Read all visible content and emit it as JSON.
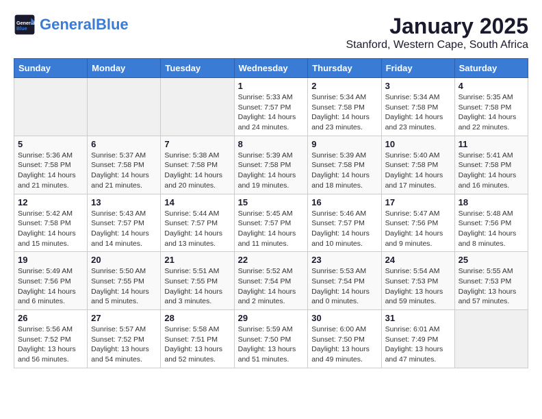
{
  "logo": {
    "text_general": "General",
    "text_blue": "Blue"
  },
  "title": "January 2025",
  "subtitle": "Stanford, Western Cape, South Africa",
  "headers": [
    "Sunday",
    "Monday",
    "Tuesday",
    "Wednesday",
    "Thursday",
    "Friday",
    "Saturday"
  ],
  "weeks": [
    [
      {
        "num": "",
        "info": ""
      },
      {
        "num": "",
        "info": ""
      },
      {
        "num": "",
        "info": ""
      },
      {
        "num": "1",
        "info": "Sunrise: 5:33 AM\nSunset: 7:57 PM\nDaylight: 14 hours\nand 24 minutes."
      },
      {
        "num": "2",
        "info": "Sunrise: 5:34 AM\nSunset: 7:58 PM\nDaylight: 14 hours\nand 23 minutes."
      },
      {
        "num": "3",
        "info": "Sunrise: 5:34 AM\nSunset: 7:58 PM\nDaylight: 14 hours\nand 23 minutes."
      },
      {
        "num": "4",
        "info": "Sunrise: 5:35 AM\nSunset: 7:58 PM\nDaylight: 14 hours\nand 22 minutes."
      }
    ],
    [
      {
        "num": "5",
        "info": "Sunrise: 5:36 AM\nSunset: 7:58 PM\nDaylight: 14 hours\nand 21 minutes."
      },
      {
        "num": "6",
        "info": "Sunrise: 5:37 AM\nSunset: 7:58 PM\nDaylight: 14 hours\nand 21 minutes."
      },
      {
        "num": "7",
        "info": "Sunrise: 5:38 AM\nSunset: 7:58 PM\nDaylight: 14 hours\nand 20 minutes."
      },
      {
        "num": "8",
        "info": "Sunrise: 5:39 AM\nSunset: 7:58 PM\nDaylight: 14 hours\nand 19 minutes."
      },
      {
        "num": "9",
        "info": "Sunrise: 5:39 AM\nSunset: 7:58 PM\nDaylight: 14 hours\nand 18 minutes."
      },
      {
        "num": "10",
        "info": "Sunrise: 5:40 AM\nSunset: 7:58 PM\nDaylight: 14 hours\nand 17 minutes."
      },
      {
        "num": "11",
        "info": "Sunrise: 5:41 AM\nSunset: 7:58 PM\nDaylight: 14 hours\nand 16 minutes."
      }
    ],
    [
      {
        "num": "12",
        "info": "Sunrise: 5:42 AM\nSunset: 7:58 PM\nDaylight: 14 hours\nand 15 minutes."
      },
      {
        "num": "13",
        "info": "Sunrise: 5:43 AM\nSunset: 7:57 PM\nDaylight: 14 hours\nand 14 minutes."
      },
      {
        "num": "14",
        "info": "Sunrise: 5:44 AM\nSunset: 7:57 PM\nDaylight: 14 hours\nand 13 minutes."
      },
      {
        "num": "15",
        "info": "Sunrise: 5:45 AM\nSunset: 7:57 PM\nDaylight: 14 hours\nand 11 minutes."
      },
      {
        "num": "16",
        "info": "Sunrise: 5:46 AM\nSunset: 7:57 PM\nDaylight: 14 hours\nand 10 minutes."
      },
      {
        "num": "17",
        "info": "Sunrise: 5:47 AM\nSunset: 7:56 PM\nDaylight: 14 hours\nand 9 minutes."
      },
      {
        "num": "18",
        "info": "Sunrise: 5:48 AM\nSunset: 7:56 PM\nDaylight: 14 hours\nand 8 minutes."
      }
    ],
    [
      {
        "num": "19",
        "info": "Sunrise: 5:49 AM\nSunset: 7:56 PM\nDaylight: 14 hours\nand 6 minutes."
      },
      {
        "num": "20",
        "info": "Sunrise: 5:50 AM\nSunset: 7:55 PM\nDaylight: 14 hours\nand 5 minutes."
      },
      {
        "num": "21",
        "info": "Sunrise: 5:51 AM\nSunset: 7:55 PM\nDaylight: 14 hours\nand 3 minutes."
      },
      {
        "num": "22",
        "info": "Sunrise: 5:52 AM\nSunset: 7:54 PM\nDaylight: 14 hours\nand 2 minutes."
      },
      {
        "num": "23",
        "info": "Sunrise: 5:53 AM\nSunset: 7:54 PM\nDaylight: 14 hours\nand 0 minutes."
      },
      {
        "num": "24",
        "info": "Sunrise: 5:54 AM\nSunset: 7:53 PM\nDaylight: 13 hours\nand 59 minutes."
      },
      {
        "num": "25",
        "info": "Sunrise: 5:55 AM\nSunset: 7:53 PM\nDaylight: 13 hours\nand 57 minutes."
      }
    ],
    [
      {
        "num": "26",
        "info": "Sunrise: 5:56 AM\nSunset: 7:52 PM\nDaylight: 13 hours\nand 56 minutes."
      },
      {
        "num": "27",
        "info": "Sunrise: 5:57 AM\nSunset: 7:52 PM\nDaylight: 13 hours\nand 54 minutes."
      },
      {
        "num": "28",
        "info": "Sunrise: 5:58 AM\nSunset: 7:51 PM\nDaylight: 13 hours\nand 52 minutes."
      },
      {
        "num": "29",
        "info": "Sunrise: 5:59 AM\nSunset: 7:50 PM\nDaylight: 13 hours\nand 51 minutes."
      },
      {
        "num": "30",
        "info": "Sunrise: 6:00 AM\nSunset: 7:50 PM\nDaylight: 13 hours\nand 49 minutes."
      },
      {
        "num": "31",
        "info": "Sunrise: 6:01 AM\nSunset: 7:49 PM\nDaylight: 13 hours\nand 47 minutes."
      },
      {
        "num": "",
        "info": ""
      }
    ]
  ]
}
